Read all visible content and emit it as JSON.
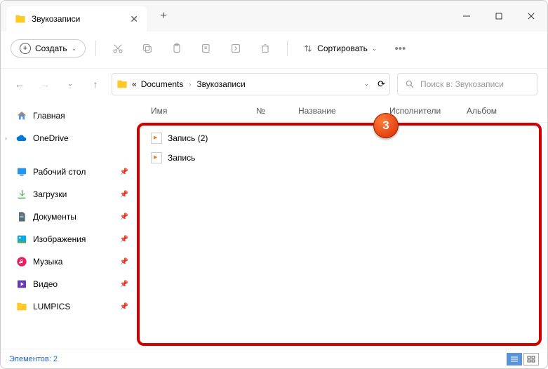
{
  "tab": {
    "title": "Звукозаписи"
  },
  "toolbar": {
    "create_label": "Создать",
    "sort_label": "Сортировать"
  },
  "address": {
    "parent": "Documents",
    "current": "Звукозаписи",
    "search_placeholder": "Поиск в: Звукозаписи"
  },
  "sidebar": {
    "home": "Главная",
    "onedrive": "OneDrive",
    "desktop": "Рабочий стол",
    "downloads": "Загрузки",
    "documents": "Документы",
    "pictures": "Изображения",
    "music": "Музыка",
    "videos": "Видео",
    "lumpics": "LUMPICS"
  },
  "columns": {
    "name": "Имя",
    "num": "№",
    "title": "Название",
    "artist": "Исполнители",
    "album": "Альбом"
  },
  "files": {
    "f1": "Запись (2)",
    "f2": "Запись"
  },
  "status": {
    "count": "Элементов: 2"
  },
  "annotation": {
    "num": "3"
  }
}
